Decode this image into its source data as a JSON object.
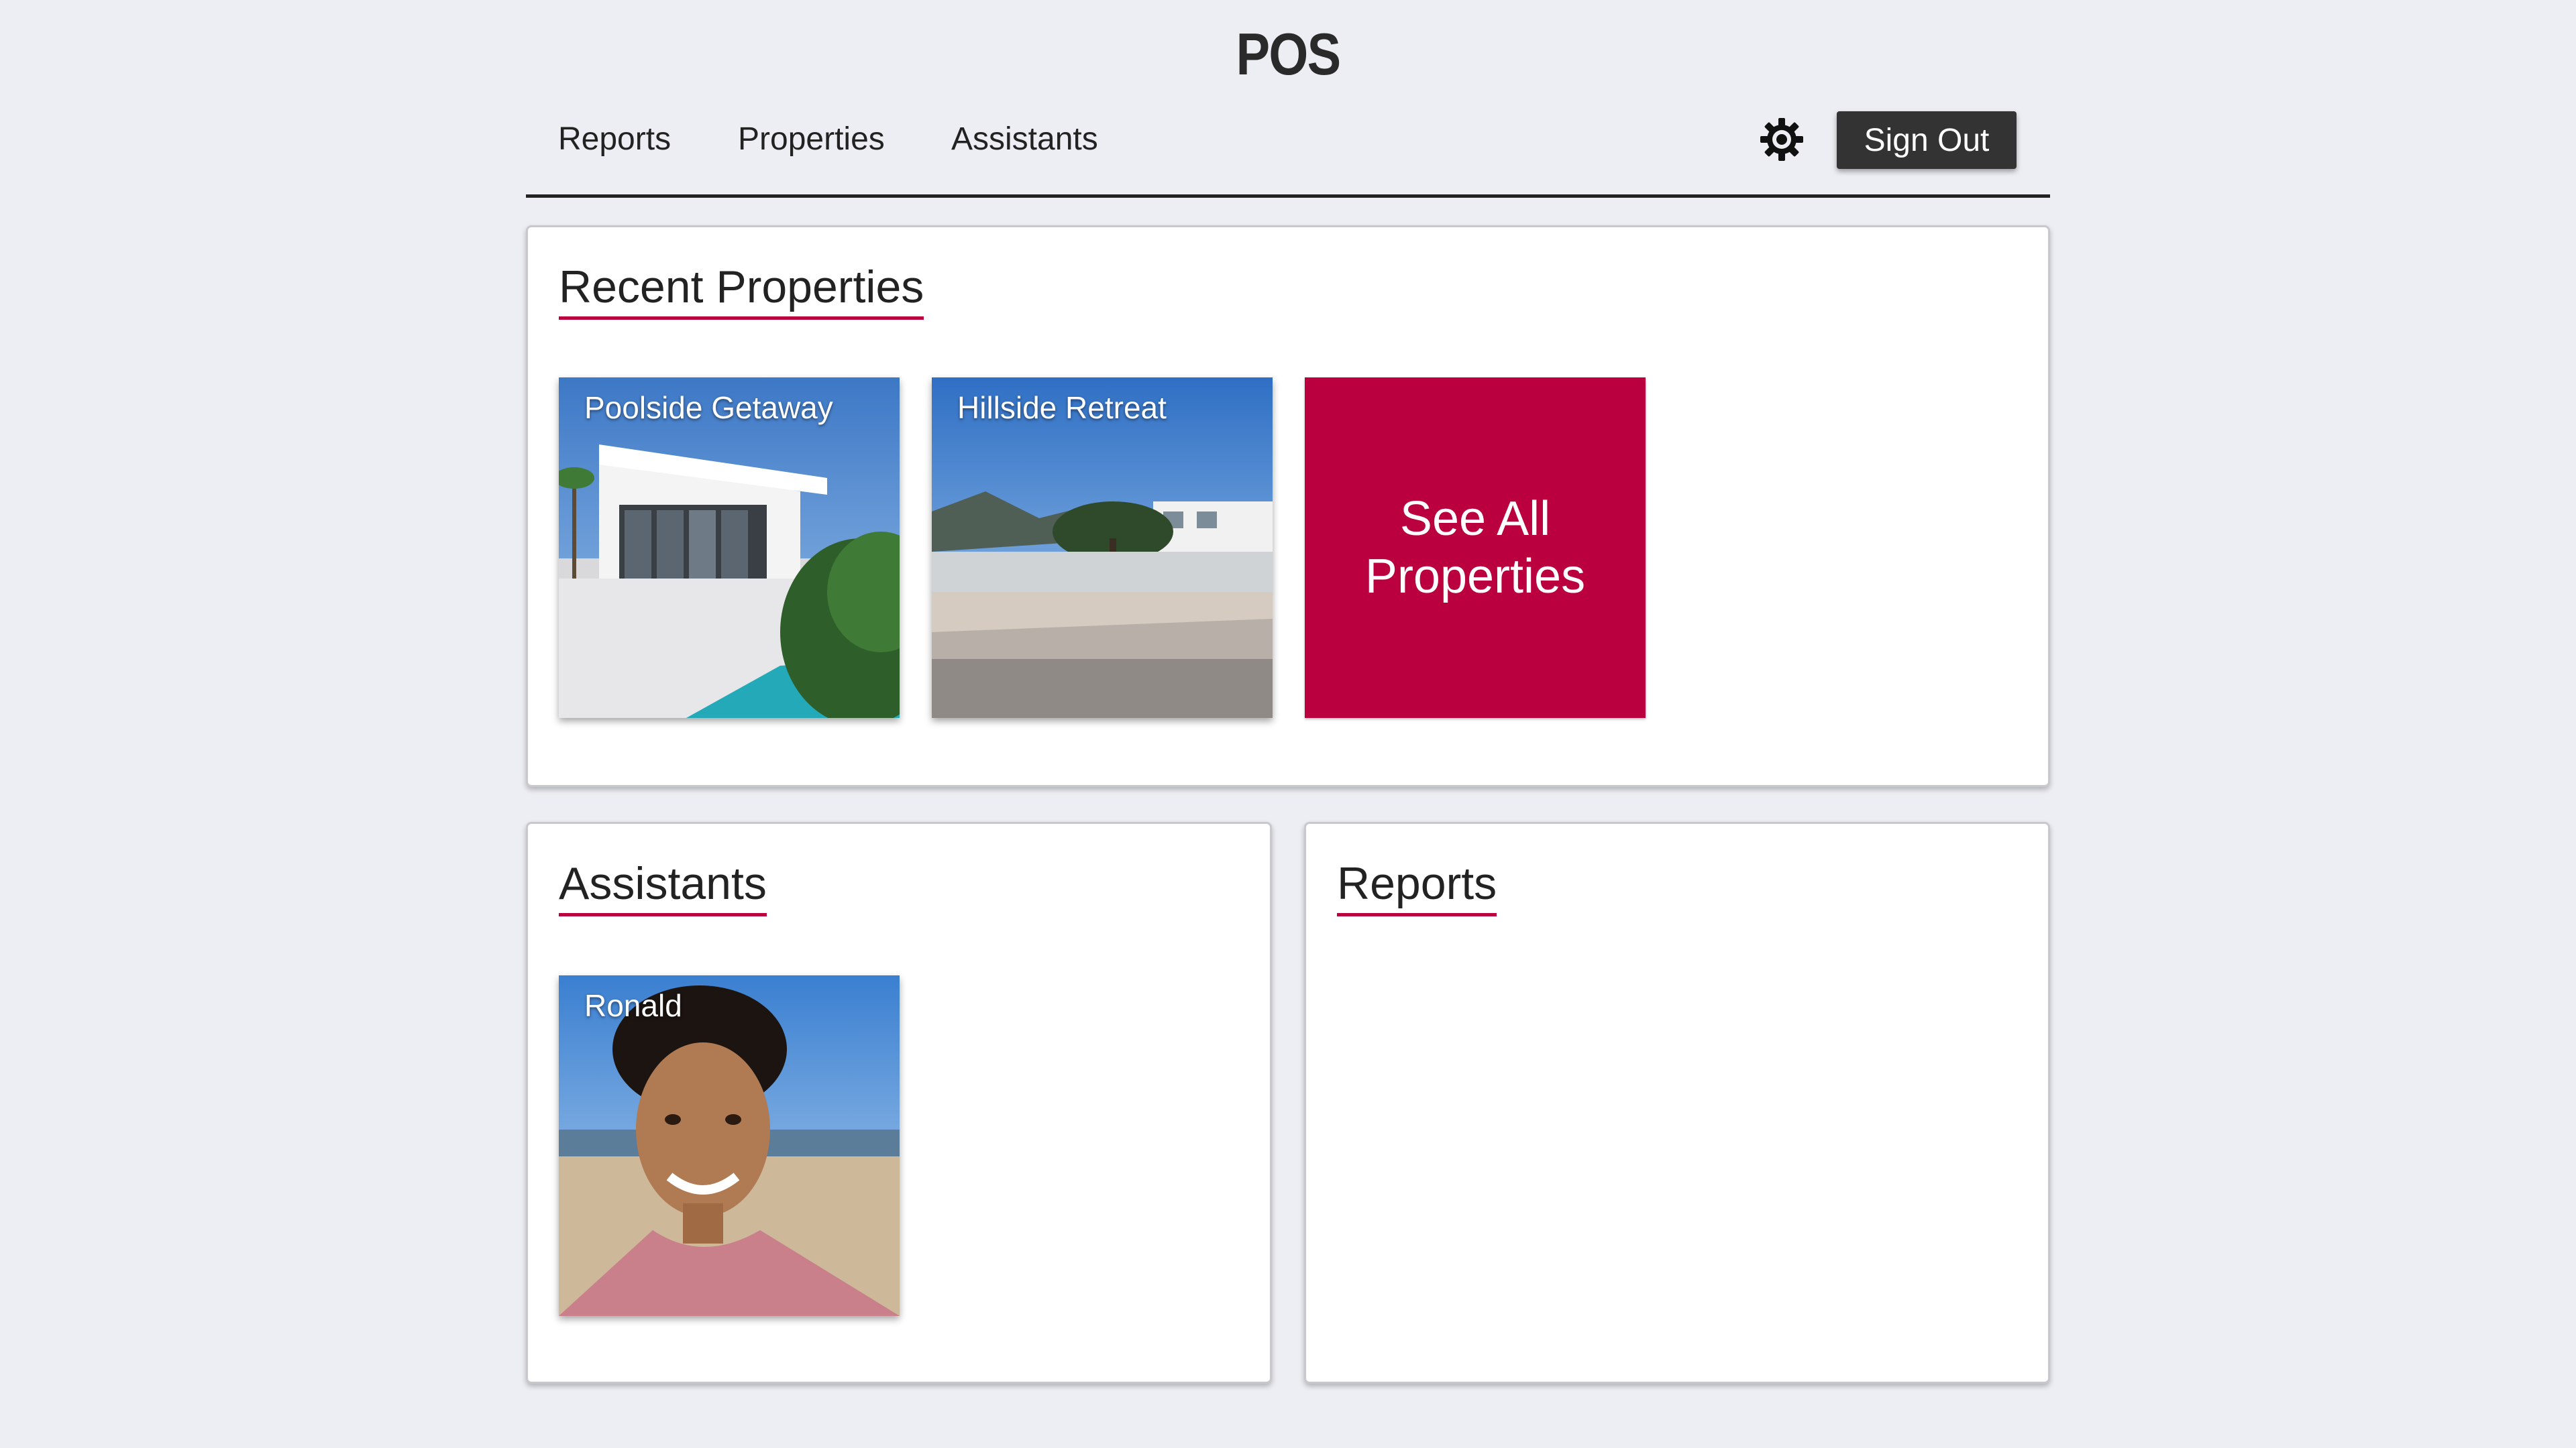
{
  "header": {
    "title": "POS"
  },
  "nav": {
    "links": [
      "Reports",
      "Properties",
      "Assistants"
    ],
    "settings_icon": "gear-icon",
    "sign_out_label": "Sign Out"
  },
  "recent_properties": {
    "title": "Recent Properties",
    "properties": [
      {
        "name": "Poolside Getaway"
      },
      {
        "name": "Hillside Retreat"
      }
    ],
    "see_all_label": "See All Properties"
  },
  "assistants": {
    "title": "Assistants",
    "people": [
      {
        "name": "Ronald"
      }
    ]
  },
  "reports": {
    "title": "Reports"
  },
  "colors": {
    "accent": "#b8003f",
    "background": "#edeef3",
    "button_dark": "#333333"
  }
}
